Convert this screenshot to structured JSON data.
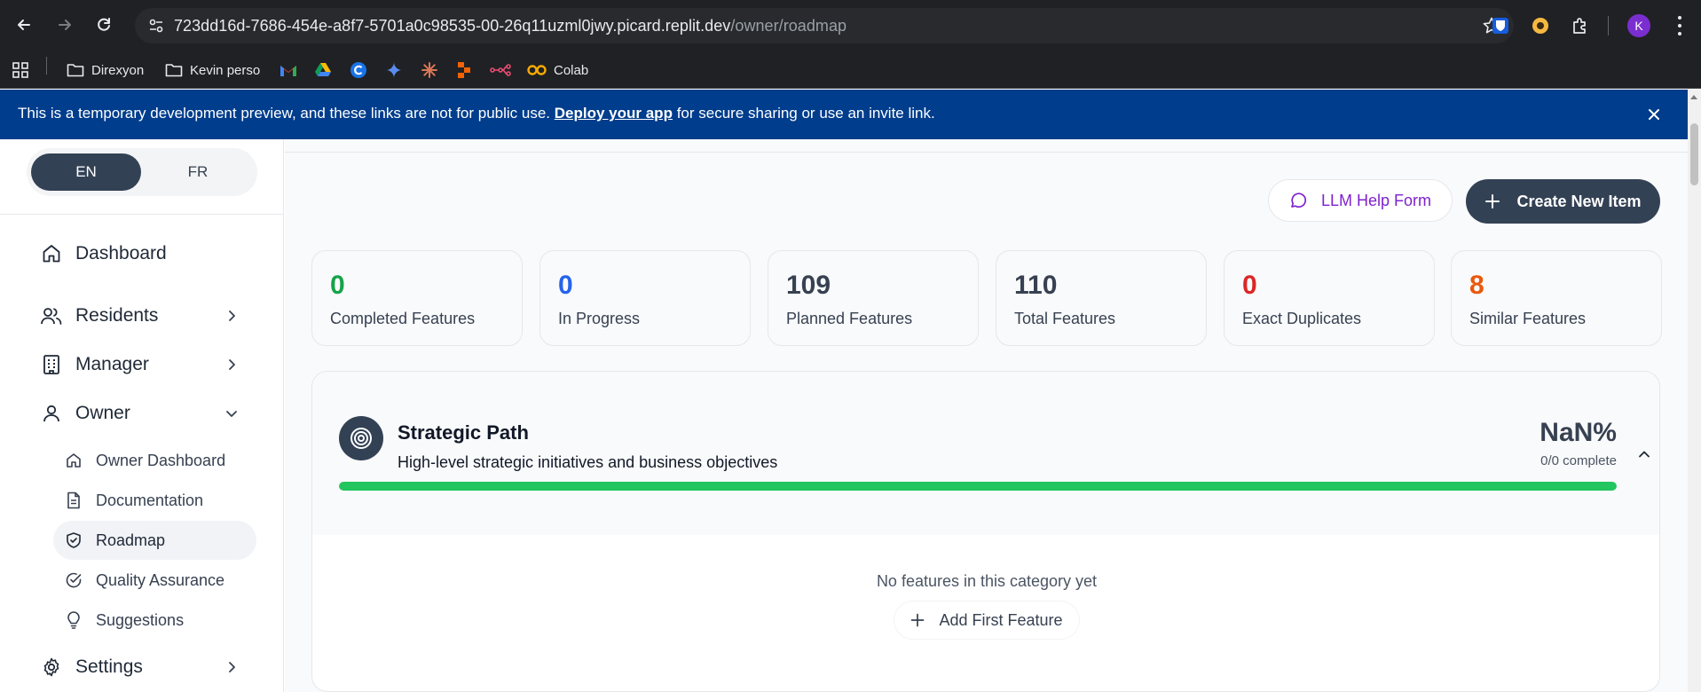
{
  "browser": {
    "url_host": "723dd16d-7686-454e-a8f7-5701a0c98535-00-26q11uzml0jwy.picard.replit.dev",
    "url_path": "/owner/roadmap",
    "profile_initial": "K",
    "bookmarks": [
      {
        "label": "Direxyon",
        "icon": "folder-icon"
      },
      {
        "label": "Kevin perso",
        "icon": "folder-icon"
      },
      {
        "label": "",
        "icon": "gmail-icon"
      },
      {
        "label": "",
        "icon": "drive-icon"
      },
      {
        "label": "",
        "icon": "c-icon"
      },
      {
        "label": "",
        "icon": "gemini-icon"
      },
      {
        "label": "",
        "icon": "claude-icon"
      },
      {
        "label": "",
        "icon": "replit-icon"
      },
      {
        "label": "",
        "icon": "n8n-icon"
      },
      {
        "label": "Colab",
        "icon": "colab-icon"
      }
    ]
  },
  "banner": {
    "text_before": "This is a temporary development preview, and these links are not for public use.",
    "link": "Deploy your app",
    "text_after": "for secure sharing or use an invite link.",
    "color": "#003d8c"
  },
  "sidebar": {
    "languages": [
      {
        "label": "EN",
        "active": true
      },
      {
        "label": "FR",
        "active": false
      }
    ],
    "items": [
      {
        "label": "Dashboard",
        "icon": "home-icon"
      },
      {
        "label": "Residents",
        "icon": "users-icon"
      },
      {
        "label": "Manager",
        "icon": "building-icon"
      },
      {
        "label": "Owner",
        "icon": "user-icon"
      }
    ],
    "owner_sub": [
      {
        "label": "Owner Dashboard",
        "icon": "home-icon"
      },
      {
        "label": "Documentation",
        "icon": "file-text-icon"
      },
      {
        "label": "Roadmap",
        "icon": "shield-check-icon",
        "active": true
      },
      {
        "label": "Quality Assurance",
        "icon": "check-circle-icon"
      },
      {
        "label": "Suggestions",
        "icon": "lightbulb-icon"
      }
    ],
    "settings": {
      "label": "Settings",
      "icon": "gear-icon"
    }
  },
  "actions": {
    "llm_help": "LLM Help Form",
    "create_new": "Create New Item"
  },
  "stats": [
    {
      "value": "0",
      "label": "Completed Features",
      "color": "#16a34a"
    },
    {
      "value": "0",
      "label": "In Progress",
      "color": "#2563eb"
    },
    {
      "value": "109",
      "label": "Planned Features",
      "color": "#374151"
    },
    {
      "value": "110",
      "label": "Total Features",
      "color": "#374151"
    },
    {
      "value": "0",
      "label": "Exact Duplicates",
      "color": "#dc2626"
    },
    {
      "value": "8",
      "label": "Similar Features",
      "color": "#ea580c"
    }
  ],
  "category": {
    "title": "Strategic Path",
    "description": "High-level strategic initiatives and business objectives",
    "percent": "NaN%",
    "count": "0/0 complete",
    "progress_fill": 1.0,
    "progress_color": "#22c55e",
    "empty_message": "No features in this category yet",
    "add_first": "Add First Feature"
  }
}
